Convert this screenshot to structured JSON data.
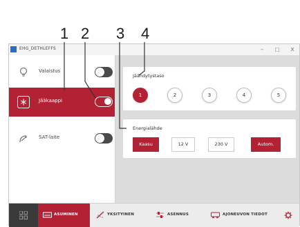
{
  "callouts": [
    "1",
    "2",
    "3",
    "4"
  ],
  "window": {
    "title": "EHG_DETHLEFFS",
    "min_glyph": "–",
    "max_glyph": "□",
    "close_glyph": "x"
  },
  "sidebar": {
    "items": [
      {
        "label": "Valaistus",
        "icon": "lightbulb-icon",
        "state": "off"
      },
      {
        "label": "Jääkaappi",
        "icon": "snowflake-icon",
        "state": "on"
      },
      {
        "label": "SAT-laite",
        "icon": "satellite-dish-icon",
        "state": "off"
      }
    ]
  },
  "cooling": {
    "title": "Jäähdytystaso",
    "levels": [
      "1",
      "2",
      "3",
      "4",
      "5"
    ],
    "selected_level": "1"
  },
  "energy": {
    "title": "Energialähde",
    "options": [
      "Kaasu",
      "12 V",
      "230 V",
      "Autom."
    ],
    "active": [
      "Kaasu",
      "Autom."
    ]
  },
  "bottom_nav": {
    "tabs": [
      {
        "label": "ASUMINEN",
        "icon": "living-area-icon",
        "active": true
      },
      {
        "label": "YKSITYINEN",
        "icon": "shower-icon",
        "active": false
      },
      {
        "label": "ASENNUS",
        "icon": "equalizer-icon",
        "active": false
      },
      {
        "label": "AJONEUVON TIEDOT",
        "icon": "vehicle-icon",
        "active": false
      }
    ]
  },
  "colors": {
    "accent": "#b22234",
    "background": "#dcdcdc",
    "toggle_off": "#4a4a4a"
  }
}
